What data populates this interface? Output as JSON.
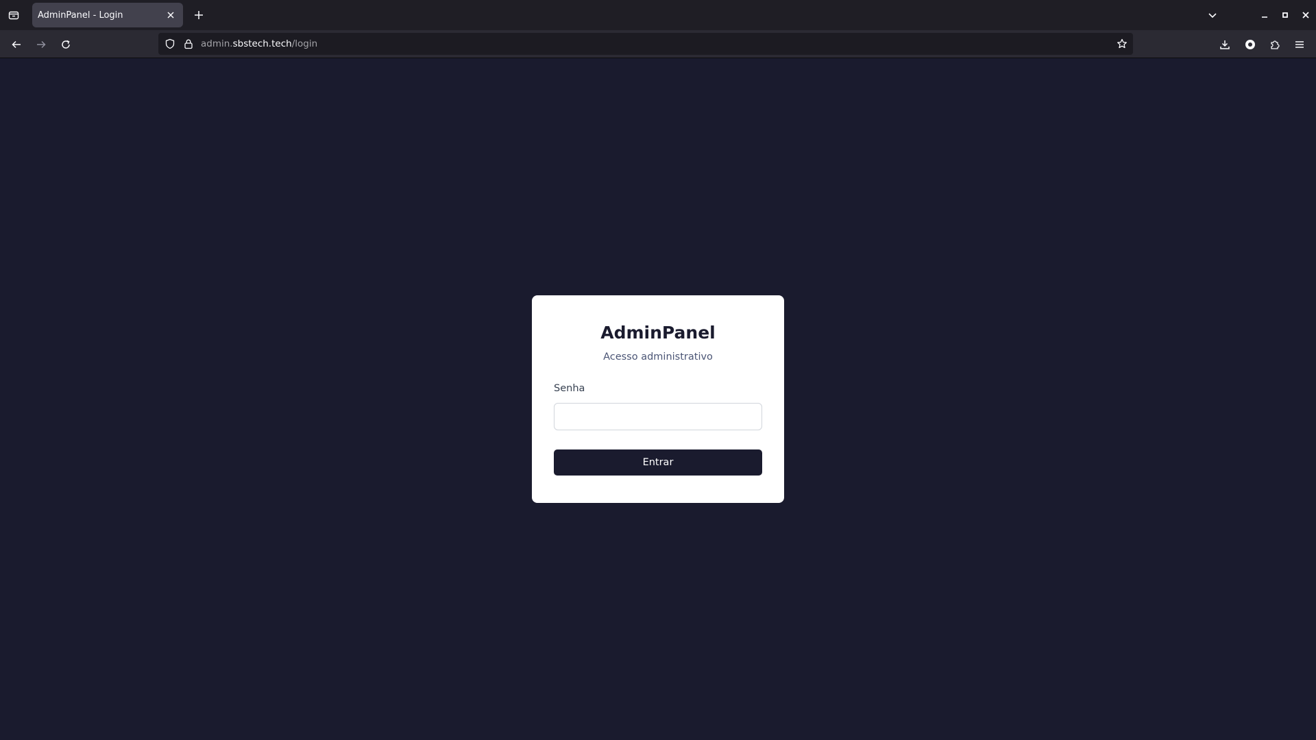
{
  "browser": {
    "tab": {
      "title": "AdminPanel - Login"
    },
    "url": {
      "host_prefix": "admin.",
      "host": "sbstech.tech",
      "path": "/login"
    },
    "icons": {
      "tab_list": "tab-list-icon",
      "close_tab": "close-icon",
      "new_tab": "plus-icon",
      "tab_overflow": "chevron-down-icon",
      "back": "back-arrow-icon",
      "forward": "forward-arrow-icon",
      "reload": "reload-icon",
      "tracking_protection": "shield-icon",
      "site_security": "lock-icon",
      "bookmark": "star-icon",
      "downloads": "download-icon",
      "account": "account-icon",
      "extensions": "puzzle-icon",
      "menu": "hamburger-menu-icon",
      "minimize": "minimize-icon",
      "maximize": "maximize-icon",
      "close_window": "close-icon"
    }
  },
  "login": {
    "title": "AdminPanel",
    "subtitle": "Acesso administrativo",
    "password_label": "Senha",
    "password_value": "",
    "submit_label": "Entrar"
  },
  "colors": {
    "page_background": "#1a1b2e",
    "card_background": "#ffffff",
    "button_background": "#1a1b2e",
    "button_text": "#ffffff",
    "title_text": "#1a1b2e",
    "subtitle_text": "#4b5575"
  }
}
